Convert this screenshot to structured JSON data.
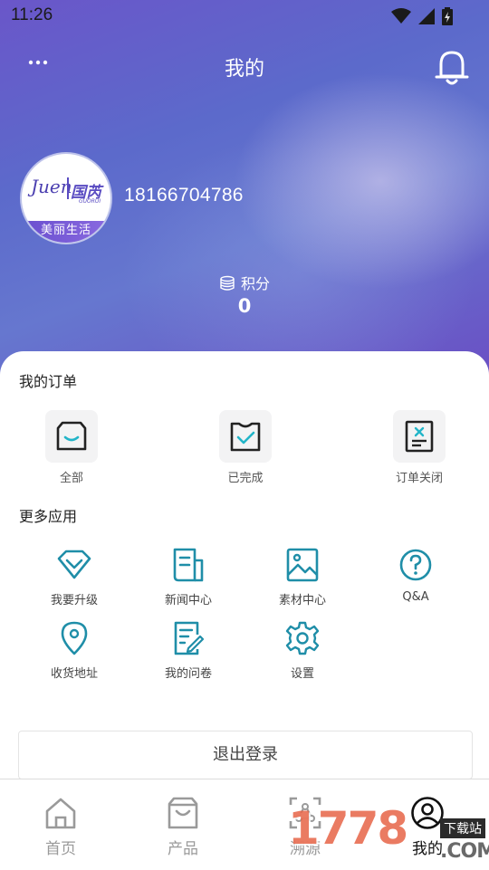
{
  "status_bar": {
    "time": "11:26",
    "icons": [
      "wifi-icon",
      "signal-icon",
      "battery-charging-icon"
    ]
  },
  "header": {
    "title": "我的",
    "more_icon": "more-dots-icon",
    "bell_icon": "bell-icon"
  },
  "profile": {
    "avatar_logo_text": "Juen",
    "avatar_logo_cn": "国芮",
    "avatar_logo_sub": "GUORUI",
    "avatar_band": "美丽生活",
    "phone": "18166704786",
    "points_label": "积分",
    "points_value": "0"
  },
  "orders": {
    "title": "我的订单",
    "items": [
      {
        "label": "全部",
        "icon": "shopping-bag-icon"
      },
      {
        "label": "已完成",
        "icon": "completed-check-icon"
      },
      {
        "label": "订单关闭",
        "icon": "order-closed-icon"
      }
    ]
  },
  "apps": {
    "title": "更多应用",
    "items": [
      {
        "label": "我要升级",
        "icon": "diamond-icon"
      },
      {
        "label": "新闻中心",
        "icon": "news-icon"
      },
      {
        "label": "素材中心",
        "icon": "image-icon"
      },
      {
        "label": "Q&A",
        "icon": "question-icon"
      },
      {
        "label": "收货地址",
        "icon": "location-pin-icon"
      },
      {
        "label": "我的问卷",
        "icon": "questionnaire-icon"
      },
      {
        "label": "设置",
        "icon": "gear-icon"
      }
    ]
  },
  "logout_label": "退出登录",
  "tabbar": {
    "items": [
      {
        "label": "首页",
        "icon": "home-icon",
        "active": false
      },
      {
        "label": "产品",
        "icon": "bag-icon",
        "active": false
      },
      {
        "label": "溯源",
        "icon": "trace-icon",
        "active": false
      },
      {
        "label": "我的",
        "icon": "user-circle-icon",
        "active": true
      }
    ]
  },
  "watermark": {
    "digits": "1778",
    "tag": "下载站",
    "suffix": ".COM"
  },
  "colors": {
    "accent": "#1f8ea8",
    "hero_start": "#6a56c9",
    "hero_end": "#6a4fc4"
  }
}
